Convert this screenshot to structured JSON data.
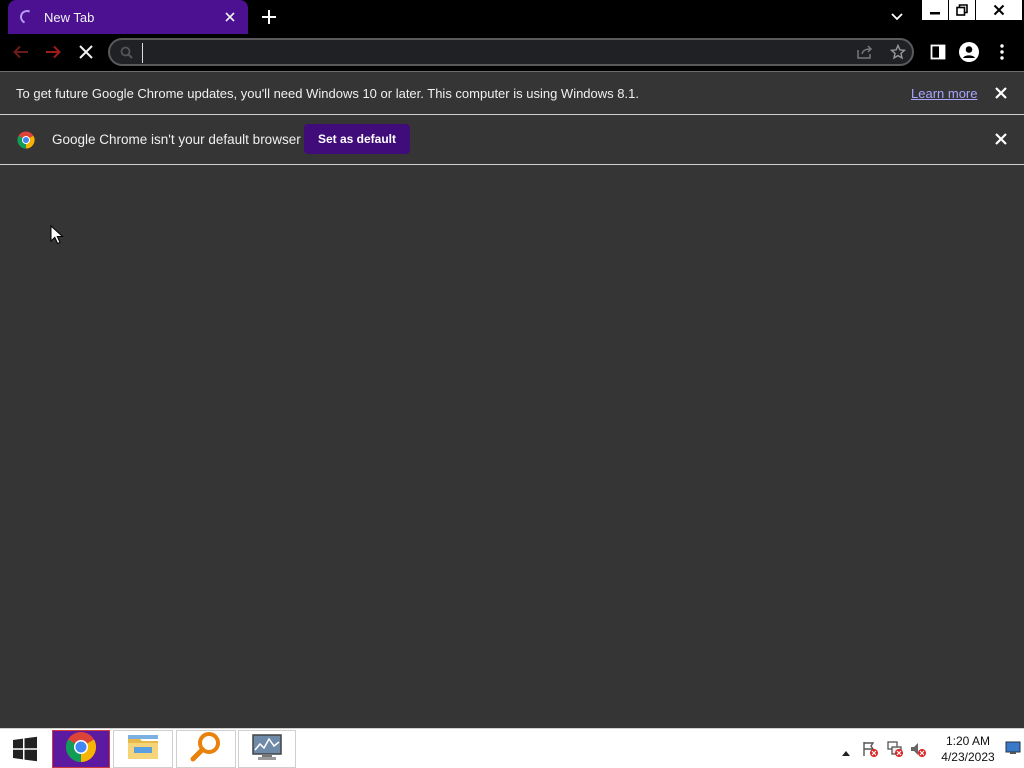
{
  "tabs": [
    {
      "title": "New Tab",
      "loading": true
    }
  ],
  "window_controls": {
    "minimize": "minimize",
    "maximize": "restore",
    "close": "close"
  },
  "omnibox": {
    "value": "",
    "placeholder": ""
  },
  "infobars": {
    "update": {
      "message": "To get future Google Chrome updates, you'll need Windows 10 or later. This computer is using Windows 8.1.",
      "link": "Learn more"
    },
    "default_browser": {
      "message": "Google Chrome isn't your default browser",
      "button": "Set as default"
    }
  },
  "taskbar": {
    "apps": [
      "start-icon",
      "chrome-icon",
      "file-explorer-icon",
      "search-magnifier-icon",
      "resource-monitor-icon"
    ],
    "clock": {
      "time": "1:20 AM",
      "date": "4/23/2023"
    }
  },
  "colors": {
    "tab_active": "#4b1190",
    "button_accent": "#3f0c79",
    "link": "#a9a6ff",
    "page_bg": "#353535"
  }
}
